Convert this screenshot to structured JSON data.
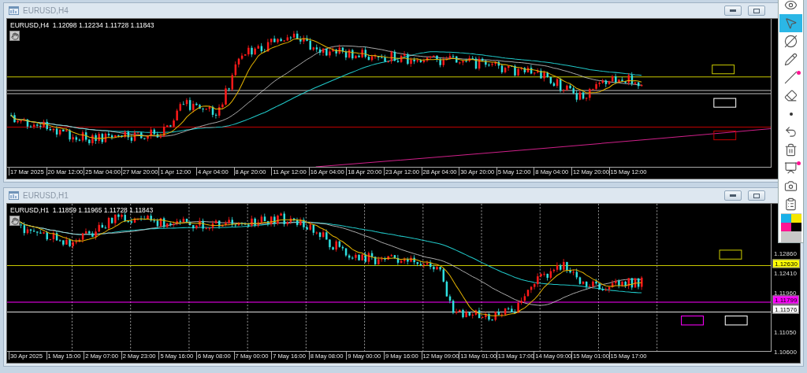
{
  "windows": [
    {
      "title": "EURUSD,H4",
      "header": "EURUSD,H4  1.12098 1.12234 1.11728 1.11843",
      "time_labels": [
        "17 Mar 2025",
        "20 Mar 12:00",
        "25 Mar 04:00",
        "27 Mar 20:00",
        "1 Apr 12:00",
        "4 Apr 04:00",
        "8 Apr 20:00",
        "11 Apr 12:00",
        "16 Apr 04:00",
        "18 Apr 20:00",
        "23 Apr 12:00",
        "28 Apr 04:00",
        "30 Apr 20:00",
        "5 May 12:00",
        "8 May 04:00",
        "12 May 20:00",
        "15 May 12:00"
      ]
    },
    {
      "title": "EURUSD,H1",
      "header": "EURUSD,H1  1.11859 1.11965 1.11728 1.11843",
      "time_labels": [
        "30 Apr 2025",
        "1 May 15:00",
        "2 May 07:00",
        "2 May 23:00",
        "5 May 16:00",
        "6 May 08:00",
        "7 May 00:00",
        "7 May 16:00",
        "8 May 08:00",
        "9 May 00:00",
        "9 May 16:00",
        "12 May 09:00",
        "13 May 01:00",
        "13 May 17:00",
        "14 May 09:00",
        "15 May 01:00",
        "15 May 17:00"
      ],
      "price_labels": [
        "1.12860",
        "1.12410",
        "1.11960",
        "1.11050",
        "1.10600"
      ],
      "price_tags": [
        {
          "text": "1.12630",
          "color": "#ffff00"
        },
        {
          "text": "1.11799",
          "color": "#ff00ff"
        },
        {
          "text": "1.11576",
          "color": "#ffffff"
        }
      ]
    }
  ],
  "toolbar": {
    "tools": [
      {
        "kind": "eye",
        "selected": false,
        "dot_badge": false
      },
      {
        "kind": "cursor",
        "selected": true,
        "dot_badge": false
      },
      {
        "kind": "crossed-circle",
        "selected": false,
        "dot_badge": false
      },
      {
        "kind": "pencil",
        "selected": false,
        "dot_badge": false
      },
      {
        "kind": "line",
        "selected": false,
        "dot_badge": true
      },
      {
        "kind": "eraser",
        "selected": false,
        "dot_badge": false
      },
      {
        "kind": "dot",
        "selected": false,
        "dot_badge": false
      },
      {
        "kind": "undo",
        "selected": false,
        "dot_badge": false
      },
      {
        "kind": "trash",
        "selected": false,
        "dot_badge": false
      },
      {
        "kind": "easel",
        "selected": false,
        "dot_badge": true
      },
      {
        "kind": "camera",
        "selected": false,
        "dot_badge": false
      },
      {
        "kind": "clipboard",
        "selected": false,
        "dot_badge": false
      }
    ],
    "palette": [
      {
        "color": "#1ab0e8"
      },
      {
        "color": "#f5e600"
      },
      {
        "color": "#ff1493"
      },
      {
        "color": "#000000"
      }
    ]
  }
}
